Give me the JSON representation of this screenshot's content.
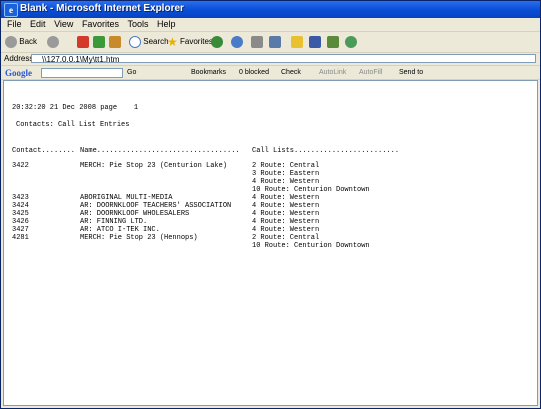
{
  "window": {
    "title": "Blank - Microsoft Internet Explorer"
  },
  "menubar": {
    "items": [
      "File",
      "Edit",
      "View",
      "Favorites",
      "Tools",
      "Help"
    ]
  },
  "toolbar": {
    "back": "Back",
    "search": "Search",
    "favorites": "Favorites"
  },
  "addressbar": {
    "label": "Address",
    "value": "\\\\127.0.0.1\\My\\tt1.htm"
  },
  "googlebar": {
    "logo": "Google",
    "go": "Go",
    "bookmarks": "Bookmarks",
    "blocked": "0 blocked",
    "check": "Check",
    "autolink": "AutoLink",
    "autofill": "AutoFill",
    "sendto": "Send to"
  },
  "report": {
    "timestamp_line": "20:32:20 21 Dec 2008 page    1",
    "subtitle": "Contacts: Call List Entries",
    "col_contact": "Contact........",
    "col_name": "Name..................................",
    "col_calllists": "Call Lists.........................",
    "rows": [
      {
        "contact": "3422",
        "name": "MERCH: Pie Stop 23 (Centurion Lake)",
        "list": "2 Route: Central"
      },
      {
        "contact": "",
        "name": "",
        "list": "3 Route: Eastern"
      },
      {
        "contact": "",
        "name": "",
        "list": "4 Route: Western"
      },
      {
        "contact": "",
        "name": "",
        "list": "10 Route: Centurion Downtown"
      },
      {
        "contact": "3423",
        "name": "ABORIGINAL MULTI-MEDIA",
        "list": "4 Route: Western"
      },
      {
        "contact": "3424",
        "name": "AR: DOORNKLOOF TEACHERS' ASSOCIATION",
        "list": "4 Route: Western"
      },
      {
        "contact": "3425",
        "name": "AR: DOORNKLOOF WHOLESALERS",
        "list": "4 Route: Western"
      },
      {
        "contact": "3426",
        "name": "AR: FINNING LTD.",
        "list": "4 Route: Western"
      },
      {
        "contact": "3427",
        "name": "AR: ATCO I-TEK INC.",
        "list": "4 Route: Western"
      },
      {
        "contact": "4281",
        "name": "MERCH: Pie Stop 23 (Hennops)",
        "list": "2 Route: Central"
      },
      {
        "contact": "",
        "name": "",
        "list": "10 Route: Centurion Downtown"
      }
    ]
  }
}
